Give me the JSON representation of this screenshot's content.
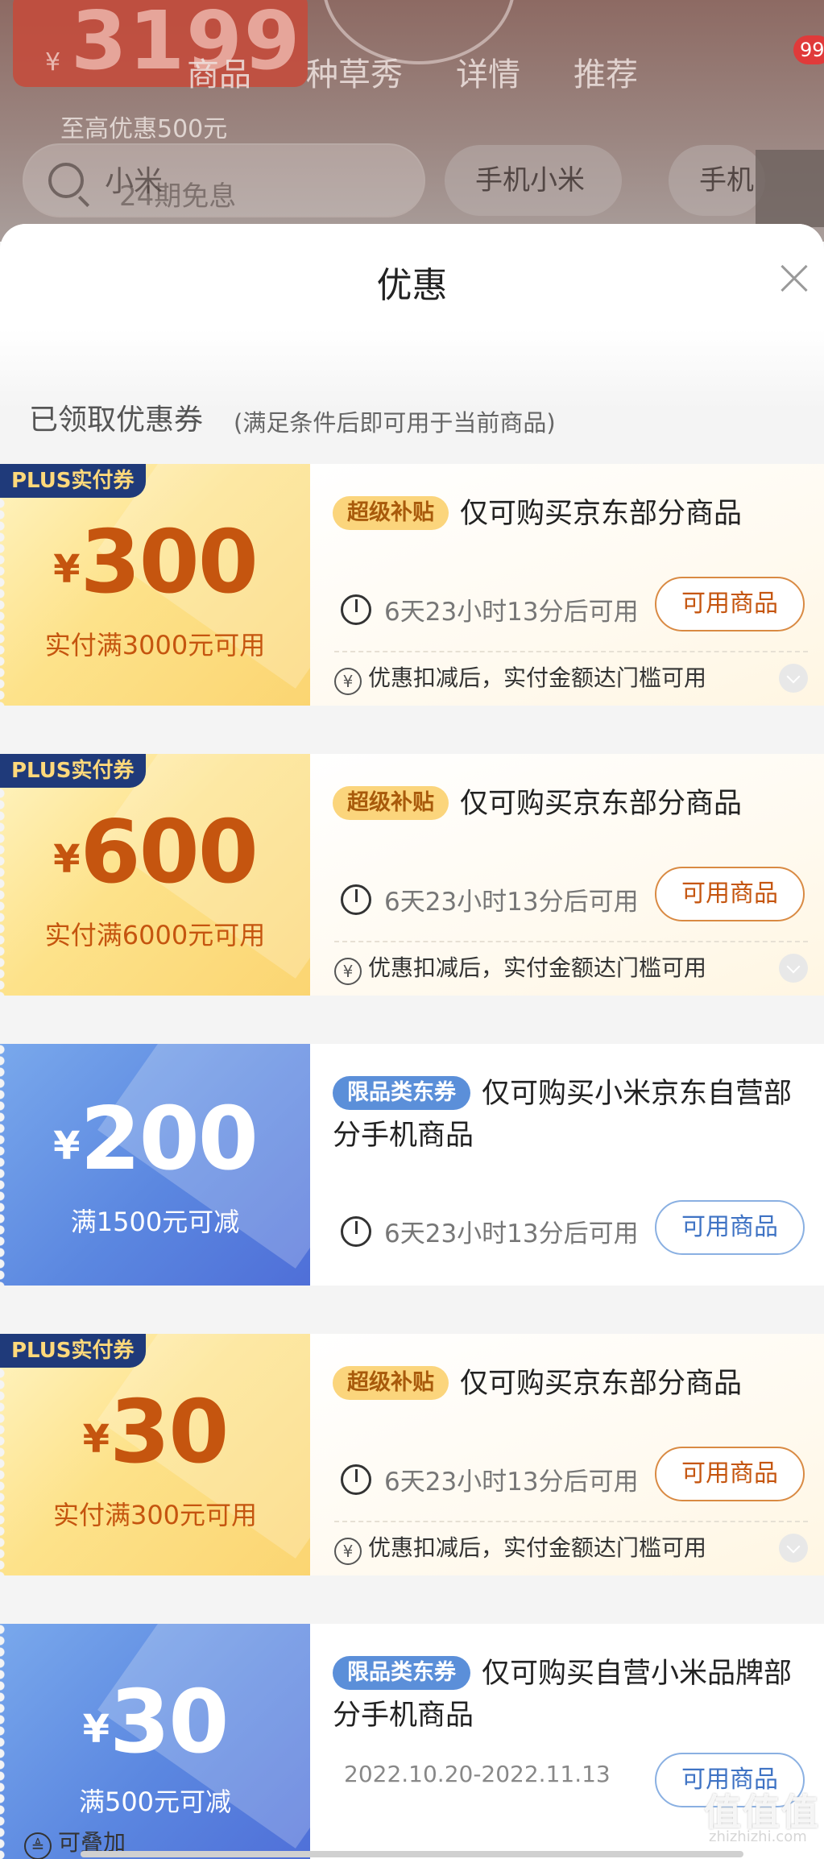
{
  "background": {
    "price": "3199",
    "currency": "¥",
    "nav_tabs": [
      "商品",
      "种草秀",
      "详情",
      "推荐"
    ],
    "cart_badge": "99",
    "discount_text": "至高优惠500元",
    "installment_text": "24期免息",
    "search_text": "小米",
    "chips": [
      "手机小米",
      "手机"
    ]
  },
  "sheet": {
    "title": "优惠",
    "section_title": "已领取优惠券",
    "section_note": "(满足条件后即可用于当前商品)"
  },
  "coupons": [
    {
      "style": "gold",
      "tag": "PLUS实付券",
      "currency": "¥",
      "amount": "300",
      "condition": "实付满3000元可用",
      "pill": "超级补贴",
      "desc": "仅可购买京东部分商品",
      "timer": "6天23小时13分后可用",
      "button": "可用商品",
      "note_icon": "¥",
      "note": "优惠扣减后，实付金额达门槛可用"
    },
    {
      "style": "gold",
      "tag": "PLUS实付券",
      "currency": "¥",
      "amount": "600",
      "condition": "实付满6000元可用",
      "pill": "超级补贴",
      "desc": "仅可购买京东部分商品",
      "timer": "6天23小时13分后可用",
      "button": "可用商品",
      "note_icon": "¥",
      "note": "优惠扣减后，实付金额达门槛可用"
    },
    {
      "style": "blue",
      "currency": "¥",
      "amount": "200",
      "condition": "满1500元可减",
      "pill": "限品类东券",
      "desc": "仅可购买小米京东自营部分手机商品",
      "timer": "6天23小时13分后可用",
      "button": "可用商品"
    },
    {
      "style": "gold",
      "tag": "PLUS实付券",
      "currency": "¥",
      "amount": "30",
      "condition": "实付满300元可用",
      "pill": "超级补贴",
      "desc": "仅可购买京东部分商品",
      "timer": "6天23小时13分后可用",
      "button": "可用商品",
      "note_icon": "¥",
      "note": "优惠扣减后，实付金额达门槛可用"
    },
    {
      "style": "blue",
      "currency": "¥",
      "amount": "30",
      "condition": "满500元可减",
      "pill": "限品类东券",
      "desc": "仅可购买自营小米品牌部分手机商品",
      "date_range": "2022.10.20-2022.11.13",
      "button": "可用商品",
      "stack_icon": "≜",
      "stack_note": "可叠加"
    }
  ],
  "watermark": {
    "main": "值值值",
    "sub": "zhizhizhi.com"
  },
  "colors": {
    "gold_amount": "#c5550f",
    "plus_tag_bg": "#1f3a7a",
    "blue_coupon": "#5b87e0",
    "gold_coupon": "#fde28a"
  }
}
